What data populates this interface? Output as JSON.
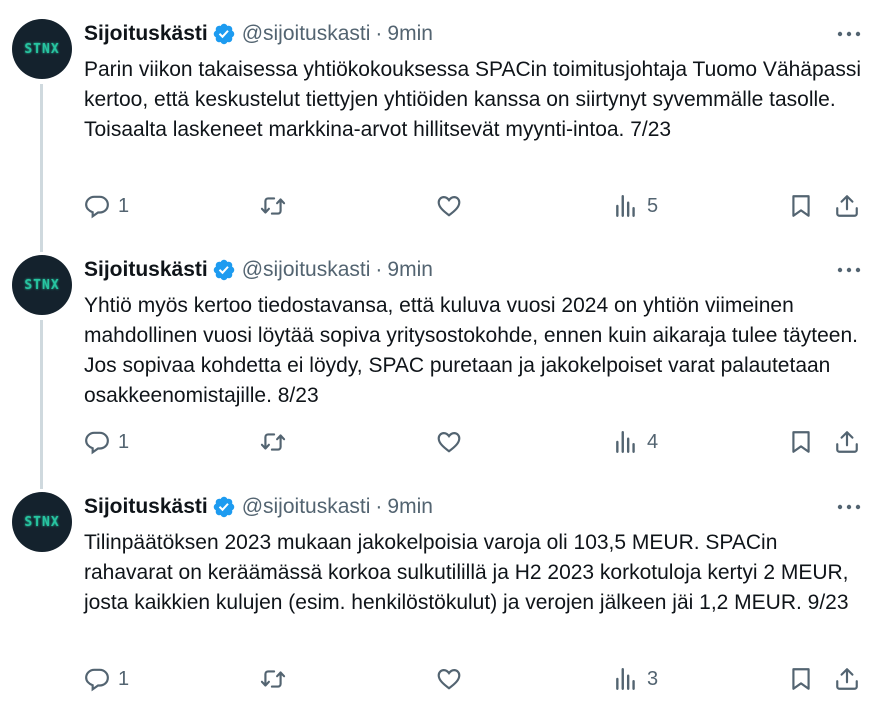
{
  "tweets": [
    {
      "name": "Sijoituskästi",
      "handle": "@sijoituskasti",
      "separator": "·",
      "time": "9min",
      "avatar_text": "STNX",
      "text": "Parin viikon takaisessa yhtiökokouksessa SPACin toimitusjohtaja Tuomo Vähäpassi kertoo, että keskustelut tiettyjen yhtiöiden kanssa on siirtynyt syvemmälle tasolle. Toisaalta laskeneet markkina-arvot hillitsevät myynti-intoa. 7/23",
      "replies": "1",
      "views": "5"
    },
    {
      "name": "Sijoituskästi",
      "handle": "@sijoituskasti",
      "separator": "·",
      "time": "9min",
      "avatar_text": "STNX",
      "text": "Yhtiö myös kertoo tiedostavansa, että kuluva vuosi 2024 on yhtiön viimeinen mahdollinen vuosi löytää sopiva yritysostokohde, ennen kuin aikaraja tulee täyteen. Jos sopivaa kohdetta ei löydy, SPAC puretaan ja jakokelpoiset varat palautetaan osakkeenomistajille. 8/23",
      "replies": "1",
      "views": "4"
    },
    {
      "name": "Sijoituskästi",
      "handle": "@sijoituskasti",
      "separator": "·",
      "time": "9min",
      "avatar_text": "STNX",
      "text": "Tilinpäätöksen 2023 mukaan jakokelpoisia varoja oli 103,5 MEUR. SPACin rahavarat on keräämässä korkoa sulkutilillä ja H2 2023 korkotuloja kertyi 2 MEUR, josta kaikkien kulujen (esim. henkilöstökulut) ja verojen jälkeen jäi 1,2 MEUR. 9/23",
      "replies": "1",
      "views": "3"
    }
  ],
  "colors": {
    "text": "#0f1419",
    "secondary": "#536471",
    "verified": "#1d9bf0",
    "thread_line": "#cfd9de"
  },
  "icons": [
    "verified-badge-icon",
    "more-icon",
    "reply-icon",
    "retweet-icon",
    "like-icon",
    "views-icon",
    "bookmark-icon",
    "share-icon"
  ]
}
